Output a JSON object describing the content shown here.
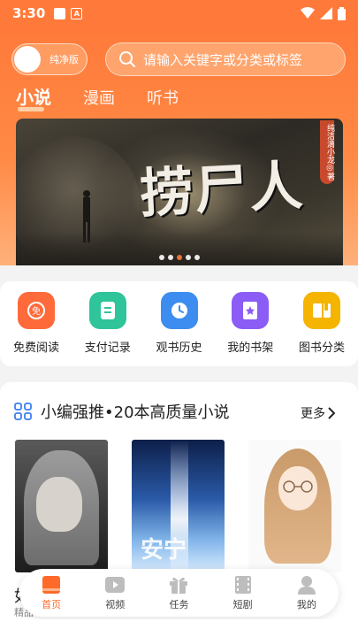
{
  "status": {
    "time": "3:30",
    "small_icon_letter": "A"
  },
  "header": {
    "toggle_label": "纯净版",
    "search_placeholder": "请输入关键字或分类或标签",
    "tabs": [
      {
        "label": "小说",
        "active": true
      },
      {
        "label": "漫画",
        "active": false
      },
      {
        "label": "听书",
        "active": false
      }
    ]
  },
  "banner": {
    "title": "捞尸人",
    "author_tag": "纯洁滴小龙◎著",
    "dots_count": 5,
    "active_dot": 2
  },
  "quick_actions": [
    {
      "label": "免费阅读",
      "icon": "free-read-icon",
      "color": "#ff6a3a"
    },
    {
      "label": "支付记录",
      "icon": "payment-record-icon",
      "color": "#2fc49a"
    },
    {
      "label": "观书历史",
      "icon": "history-clock-icon",
      "color": "#3d8cf0"
    },
    {
      "label": "我的书架",
      "icon": "bookshelf-icon",
      "color": "#8b5cf6"
    },
    {
      "label": "图书分类",
      "icon": "category-book-icon",
      "color": "#f5b400"
    }
  ],
  "recommend": {
    "title": "小编强推•20本高质量小说",
    "more_label": "更多",
    "cover2_text": "安宁",
    "peek_title": "如",
    "peek_sub": "精品"
  },
  "bottom_nav": [
    {
      "label": "首页",
      "icon": "home-book-icon",
      "active": true
    },
    {
      "label": "视频",
      "icon": "video-play-icon",
      "active": false
    },
    {
      "label": "任务",
      "icon": "gift-icon",
      "active": false
    },
    {
      "label": "短剧",
      "icon": "film-icon",
      "active": false
    },
    {
      "label": "我的",
      "icon": "user-icon",
      "active": false
    }
  ],
  "colors": {
    "brand": "#ff7a3a",
    "accent_active": "#ff6a2a"
  }
}
